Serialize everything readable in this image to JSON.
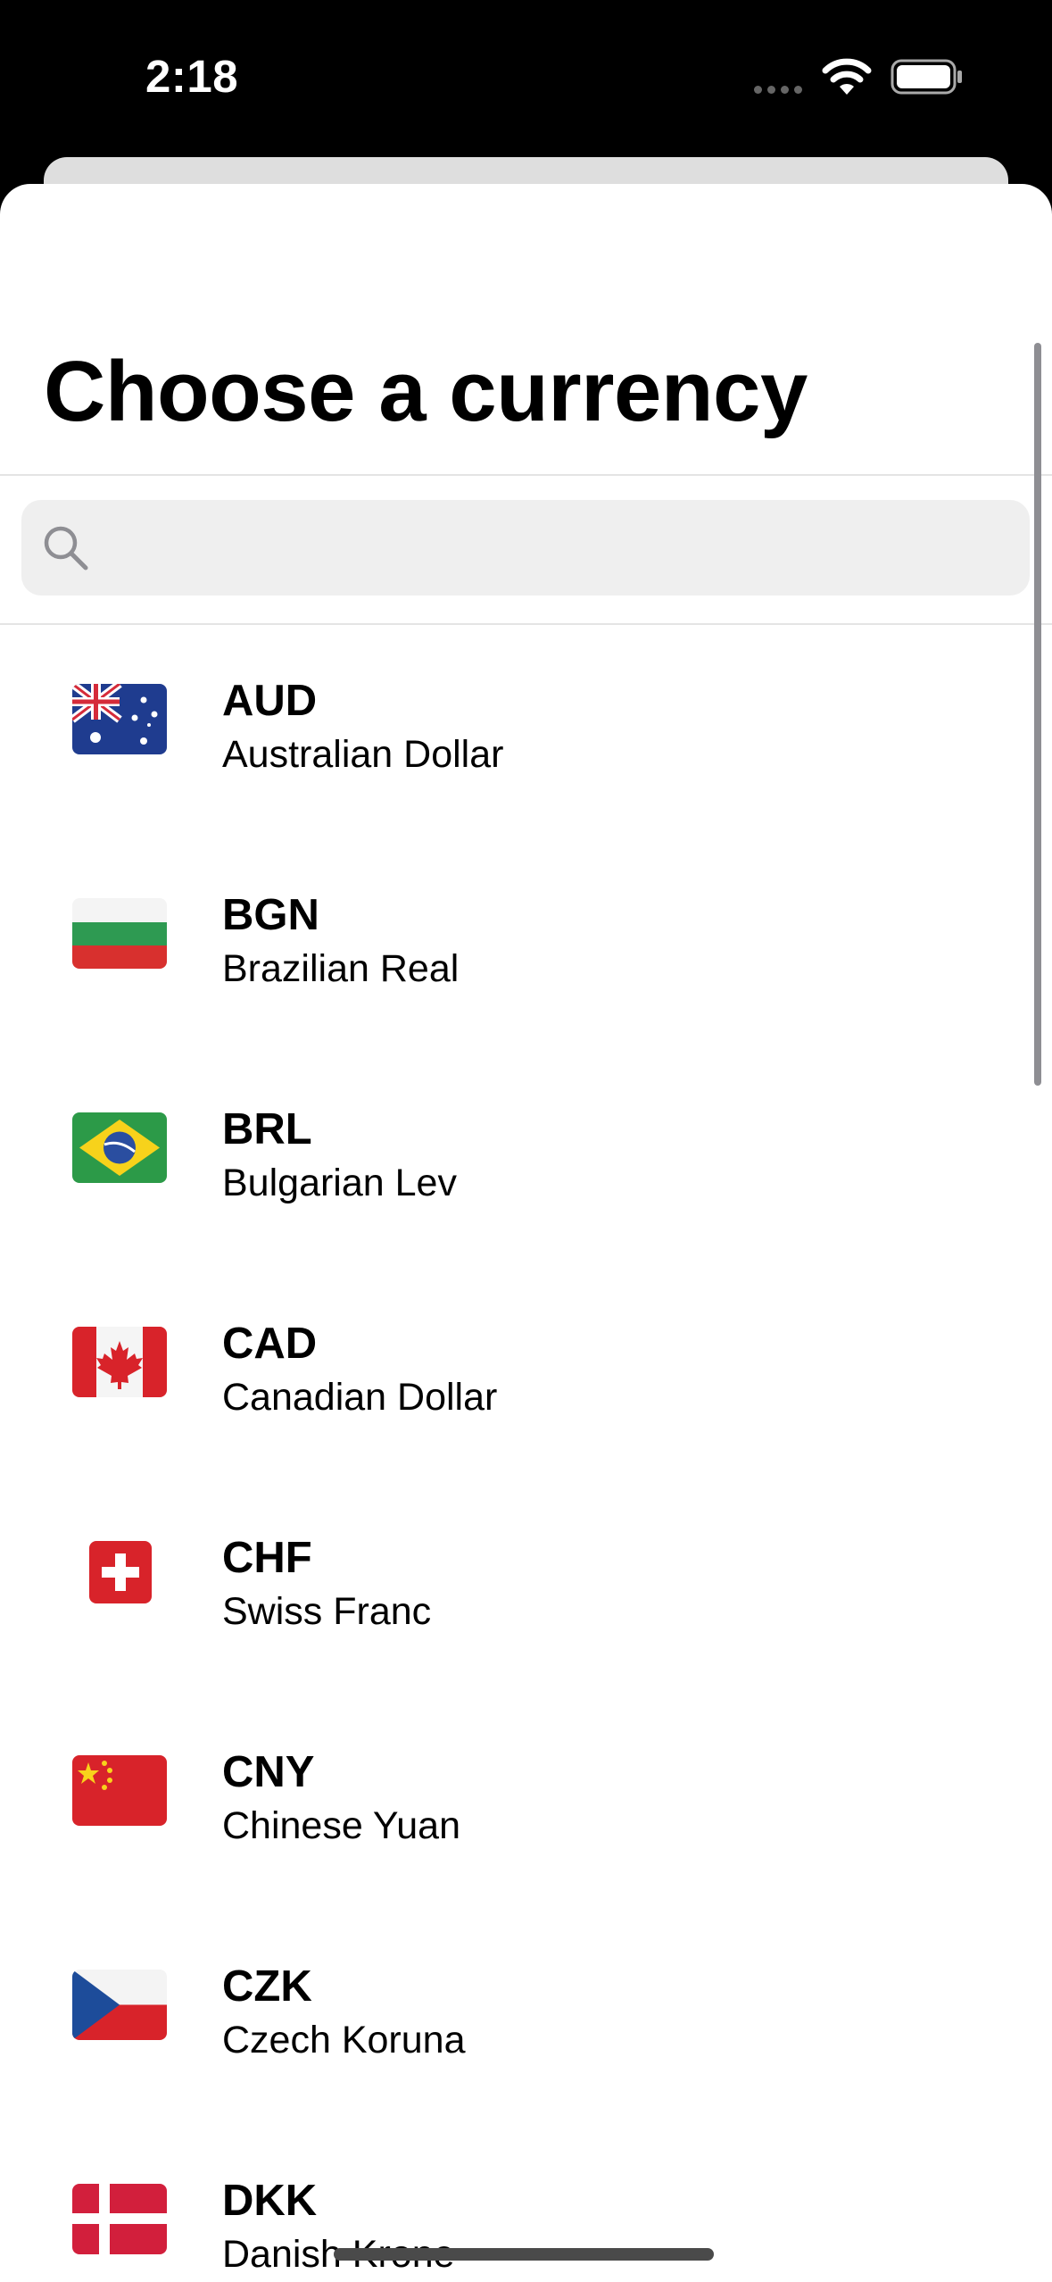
{
  "status_bar": {
    "time": "2:18",
    "wifi_icon": "wifi-icon",
    "battery_icon": "battery-icon"
  },
  "sheet": {
    "title": "Choose a currency"
  },
  "search": {
    "value": "",
    "placeholder": "",
    "icon": "search-icon"
  },
  "currencies": [
    {
      "code": "AUD",
      "name": "Australian Dollar",
      "flag": "australia-flag-icon"
    },
    {
      "code": "BGN",
      "name": "Brazilian Real",
      "flag": "bulgaria-flag-icon"
    },
    {
      "code": "BRL",
      "name": "Bulgarian Lev",
      "flag": "brazil-flag-icon"
    },
    {
      "code": "CAD",
      "name": "Canadian Dollar",
      "flag": "canada-flag-icon"
    },
    {
      "code": "CHF",
      "name": "Swiss Franc",
      "flag": "switzerland-flag-icon"
    },
    {
      "code": "CNY",
      "name": "Chinese Yuan",
      "flag": "china-flag-icon"
    },
    {
      "code": "CZK",
      "name": "Czech Koruna",
      "flag": "czech-flag-icon"
    },
    {
      "code": "DKK",
      "name": "Danish Krone",
      "flag": "denmark-flag-icon"
    }
  ],
  "colors": {
    "sheet_background": "#ffffff",
    "search_background": "#efefef",
    "status_bar_background": "#000000"
  }
}
